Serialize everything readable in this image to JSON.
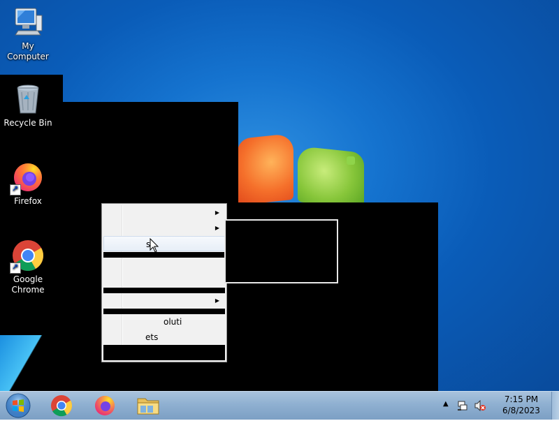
{
  "desktop": {
    "icons": [
      {
        "label": "My Computer",
        "icon": "computer-icon"
      },
      {
        "label": "Recycle Bin",
        "icon": "recycle-bin-icon"
      },
      {
        "label": "Firefox",
        "icon": "firefox-icon"
      },
      {
        "label": "Google Chrome",
        "icon": "chrome-icon"
      }
    ]
  },
  "context_menu": {
    "items": [
      {
        "label": "",
        "has_submenu": true
      },
      {
        "label": "",
        "has_submenu": true
      },
      {
        "label": "s",
        "highlighted": true
      },
      {
        "label": "",
        "has_submenu": true
      },
      {
        "label": "oluti"
      },
      {
        "label": "ets"
      }
    ]
  },
  "taskbar": {
    "start_icon": "windows-start-icon",
    "pinned": [
      "chrome-icon",
      "firefox-icon",
      "file-explorer-icon"
    ],
    "tray": {
      "overflow_icon": "show-hidden-icons-arrow",
      "network_icon": "network-icon",
      "volume_icon": "volume-muted-icon",
      "time": "7:15 PM",
      "date": "6/8/2023"
    }
  },
  "colors": {
    "desktop_blue": "#0a5cb8",
    "taskbar": "#8fb0d1",
    "menu_bg": "#f1f1f1"
  }
}
